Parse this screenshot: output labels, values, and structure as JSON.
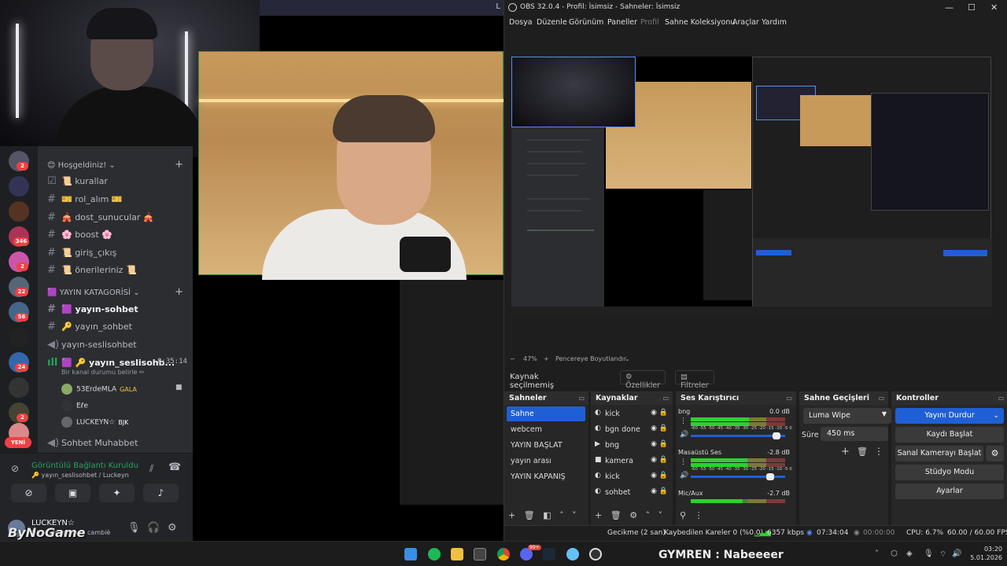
{
  "top_window": {
    "label": "L"
  },
  "discord": {
    "categories": [
      {
        "label": "😊 Hoşgeldiniz!"
      },
      {
        "label": "🟪 YAYIN KATAGORİSİ"
      }
    ],
    "channels": [
      {
        "label": "📜 kurallar"
      },
      {
        "label": "🎫 rol_alım 🎫"
      },
      {
        "label": "🎪 dost_sunucular 🎪"
      },
      {
        "label": "🌸 boost 🌸"
      },
      {
        "label": "📜 giriş_çıkış"
      },
      {
        "label": "📜 önerileriniz 📜"
      },
      {
        "label": "🟪 yayın-sohbet"
      },
      {
        "label": "🔑 yayın_sohbet"
      },
      {
        "label": "yayın-seslisohbet"
      },
      {
        "label": "🟪 🔑 yayın_seslisohb..."
      },
      {
        "label": "Sohbet Muhabbet"
      }
    ],
    "voice_timer": "8:35:14",
    "voice_status": "Bir kanal durumu belirle ✏",
    "members": [
      {
        "name": "53ErdeMLA",
        "tag": "GALA"
      },
      {
        "name": "Eℓe",
        "tag": ""
      },
      {
        "name": "LUCKEYN☆",
        "tag": "BJK"
      }
    ],
    "server_badges": [
      "2",
      "346",
      "2",
      "22",
      "56",
      "24",
      "2"
    ],
    "yeni": "YENİ",
    "rtc_title": "Görüntülü Bağlantı Kuruldu",
    "rtc_sub": "🔑 yayın_seslisohbet / Luckeyn",
    "user_name": "LUCKEYN☆",
    "user_status": "Ol... rufri, prendi, cambiè",
    "watermark": "ByNoGame"
  },
  "obs": {
    "title": "OBS 32.0.4 - Profil: İsimsiz - Sahneler: İsimsiz",
    "menu": [
      "Dosya",
      "Düzenle",
      "Görünüm",
      "Paneller",
      "Profil",
      "Sahne Koleksiyonu",
      "Araçlar",
      "Yardım"
    ],
    "zoom": "47%",
    "fit_label": "Pencereye Boyutlandır",
    "no_source": "Kaynak seçilmemiş",
    "properties_btn": "Özellikler",
    "filters_btn": "Filtreler",
    "docks": {
      "scenes": "Sahneler",
      "sources": "Kaynaklar",
      "mixer": "Ses Karıştırıcı",
      "transitions": "Sahne Geçişleri",
      "controls": "Kontroller"
    },
    "scenes": [
      "Sahne",
      "webcem",
      "YAYIN BAŞLAT",
      "yayın arası",
      "YAYIN KAPANIŞ"
    ],
    "sources": [
      "kick",
      "bgn done",
      "bng",
      "kamera",
      "kick",
      "sohbet"
    ],
    "mixer": [
      {
        "name": "bng",
        "db": "0.0 dB",
        "level": 0.62,
        "volume": 0.95
      },
      {
        "name": "Masaüstü Ses",
        "db": "-2.8 dB",
        "level": 0.6,
        "volume": 0.88
      },
      {
        "name": "Mic/Aux",
        "db": "-2.7 dB",
        "level": 0.55,
        "volume": 0.88
      }
    ],
    "meter_ticks": "-60 -55 -50 -45 -40 -35 -30 -25 -20 -15 -10 -5 0",
    "transition": "Luma Wipe",
    "duration_label": "Süre",
    "duration": "450 ms",
    "controls": [
      "Yayını Durdur",
      "Kaydı Başlat",
      "Sanal Kamerayı Başlat",
      "Stüdyo Modu",
      "Ayarlar"
    ],
    "status": {
      "delay": "Gecikme (2 san)",
      "dropped": "Kaybedilen Kareler 0 (%0.0)",
      "bitrate": "6357 kbps",
      "stream_time": "07:34:04",
      "rec_time": "00:00:00",
      "cpu": "CPU: 6.7%",
      "fps": "60.00 / 60.00 FPS"
    }
  },
  "taskbar": {
    "ticker": "GYMREN : Nabeeeer",
    "time": "03:20",
    "date": "5.01.2026",
    "notif_badge": "99+"
  },
  "colors": {
    "accent": "#1f5fd6",
    "discord_bg": "#2b2d31",
    "obs_bg": "#1f1e1f",
    "red": "#f23f43",
    "green": "#23a55a"
  }
}
